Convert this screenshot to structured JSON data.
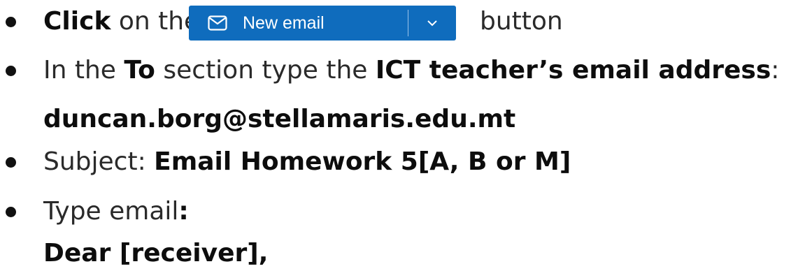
{
  "instructions": {
    "step1": {
      "prefix_bold": "Click",
      "prefix_rest": " on the",
      "button": {
        "label": "New email",
        "icon": "mail-icon",
        "dropdown_icon": "chevron-down-icon",
        "color": "#0f6cbd"
      },
      "suffix": "button"
    },
    "step2": {
      "part1": "In the ",
      "part2": "To",
      "part3": " section type the ",
      "part4": "ICT teacher’s email address",
      "part5": ":"
    },
    "email_address": "duncan.borg@stellamaris.edu.mt",
    "step3": {
      "label": "Subject: ",
      "value": "Email Homework 5[A, B or M]"
    },
    "step4": {
      "label": "Type email",
      "colon": ":"
    },
    "greeting": "Dear [receiver],"
  }
}
